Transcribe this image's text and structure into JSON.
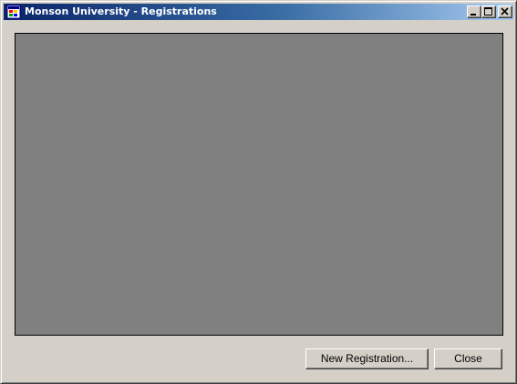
{
  "window": {
    "title": "Monson University - Registrations",
    "icon": "application-icon",
    "caption_buttons": [
      "minimize-icon",
      "maximize-icon",
      "close-icon"
    ]
  },
  "buttons": {
    "new_registration": "New Registration...",
    "close": "Close"
  },
  "colors": {
    "title_gradient_start": "#0a246a",
    "title_gradient_end": "#a6caf0",
    "window_face": "#d4d0c8",
    "content_panel": "#808080"
  }
}
